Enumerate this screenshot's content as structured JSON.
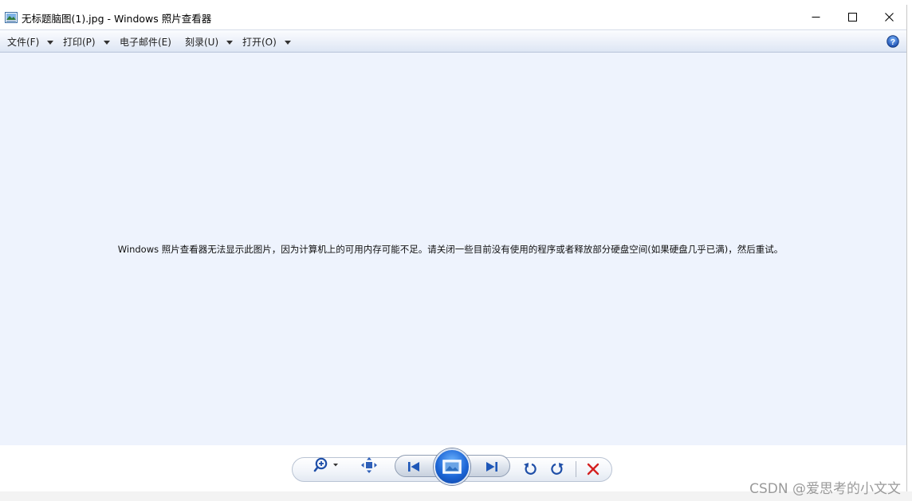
{
  "window": {
    "title": "无标题脑图(1).jpg - Windows 照片查看器",
    "icons": {
      "app": "photo-viewer-icon",
      "minimize": "minimize-icon",
      "maximize": "maximize-icon",
      "close": "close-icon"
    }
  },
  "menubar": {
    "items": [
      {
        "label": "文件(F)",
        "has_dropdown": true
      },
      {
        "label": "打印(P)",
        "has_dropdown": true
      },
      {
        "label": "电子邮件(E)",
        "has_dropdown": false
      },
      {
        "label": "刻录(U)",
        "has_dropdown": true
      },
      {
        "label": "打开(O)",
        "has_dropdown": true
      }
    ],
    "help_icon": "help-icon"
  },
  "content": {
    "message": "Windows 照片查看器无法显示此图片，因为计算机上的可用内存可能不足。请关闭一些目前没有使用的程序或者释放部分硬盘空间(如果硬盘几乎已满)，然后重试。"
  },
  "toolbar": {
    "buttons": [
      "zoom-icon",
      "actual-size-icon",
      "previous-icon",
      "slideshow-icon",
      "next-icon",
      "rotate-left-icon",
      "rotate-right-icon",
      "delete-icon"
    ]
  },
  "watermark": "CSDN @爱思考的小文文",
  "colors": {
    "content_bg": "#eef3fd",
    "accent_blue": "#1d66d6",
    "delete_red": "#d42020"
  }
}
